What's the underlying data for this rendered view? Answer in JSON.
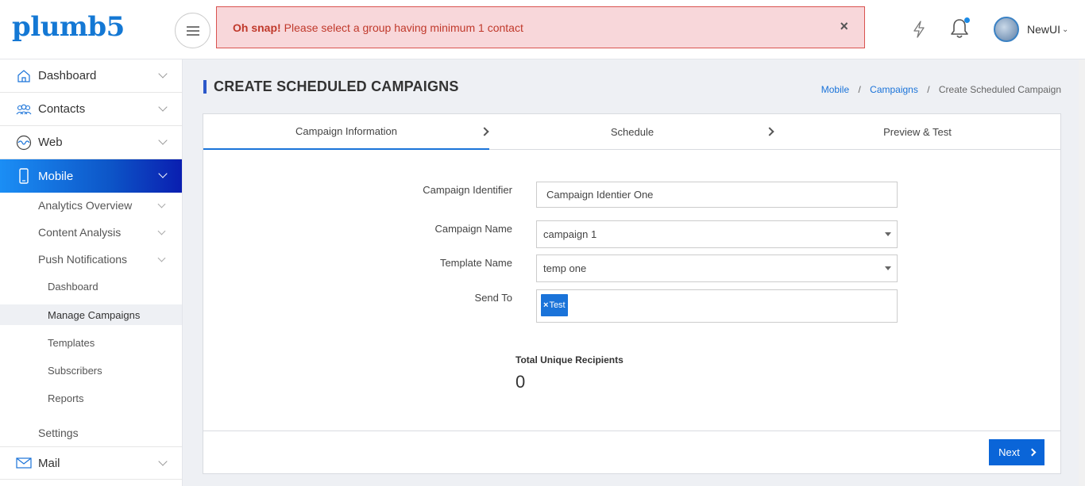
{
  "brand": {
    "logo_text": "plumb5"
  },
  "alert": {
    "strong": "Oh snap!",
    "message": "Please select a group having minimum 1 contact",
    "close": "×"
  },
  "header": {
    "user_name": "NewUI",
    "user_chevron": "⌄",
    "notification_dot_color": "#1a8ae6"
  },
  "sidebar": {
    "items": [
      {
        "label": "Dashboard",
        "icon": "home-icon"
      },
      {
        "label": "Contacts",
        "icon": "contacts-icon"
      },
      {
        "label": "Web",
        "icon": "web-icon"
      },
      {
        "label": "Mobile",
        "icon": "mobile-icon",
        "active": true
      },
      {
        "label": "Mail",
        "icon": "mail-icon"
      }
    ],
    "mobile_sub": [
      {
        "label": "Analytics Overview"
      },
      {
        "label": "Content Analysis"
      },
      {
        "label": "Push Notifications"
      }
    ],
    "push_sub": [
      {
        "label": "Dashboard"
      },
      {
        "label": "Manage Campaigns",
        "selected": true
      },
      {
        "label": "Templates"
      },
      {
        "label": "Subscribers"
      },
      {
        "label": "Reports"
      }
    ],
    "settings": "Settings"
  },
  "page": {
    "title": "CREATE SCHEDULED CAMPAIGNS",
    "breadcrumb": [
      "Mobile",
      "Campaigns",
      "Create Scheduled Campaign"
    ],
    "breadcrumb_sep": "/"
  },
  "steps": [
    {
      "label": "Campaign  Information",
      "active": true
    },
    {
      "label": "Schedule"
    },
    {
      "label": "Preview & Test"
    }
  ],
  "form": {
    "identifier_label": "Campaign Identifier",
    "identifier_value": "Campaign Identier One",
    "name_label": "Campaign Name",
    "name_value": "campaign 1",
    "template_label": "Template Name",
    "template_value": "temp one",
    "sendto_label": "Send To",
    "sendto_tags": [
      "Test"
    ],
    "tag_remove": "×"
  },
  "recipients": {
    "label": "Total Unique Recipients",
    "value": "0"
  },
  "actions": {
    "next_label": "Next"
  },
  "colors": {
    "accent": "#1a73d9",
    "alert_bg": "#f8d7da",
    "alert_text": "#c0392b",
    "active_nav_start": "#1b8ef5",
    "active_nav_end": "#0a1eb0"
  }
}
